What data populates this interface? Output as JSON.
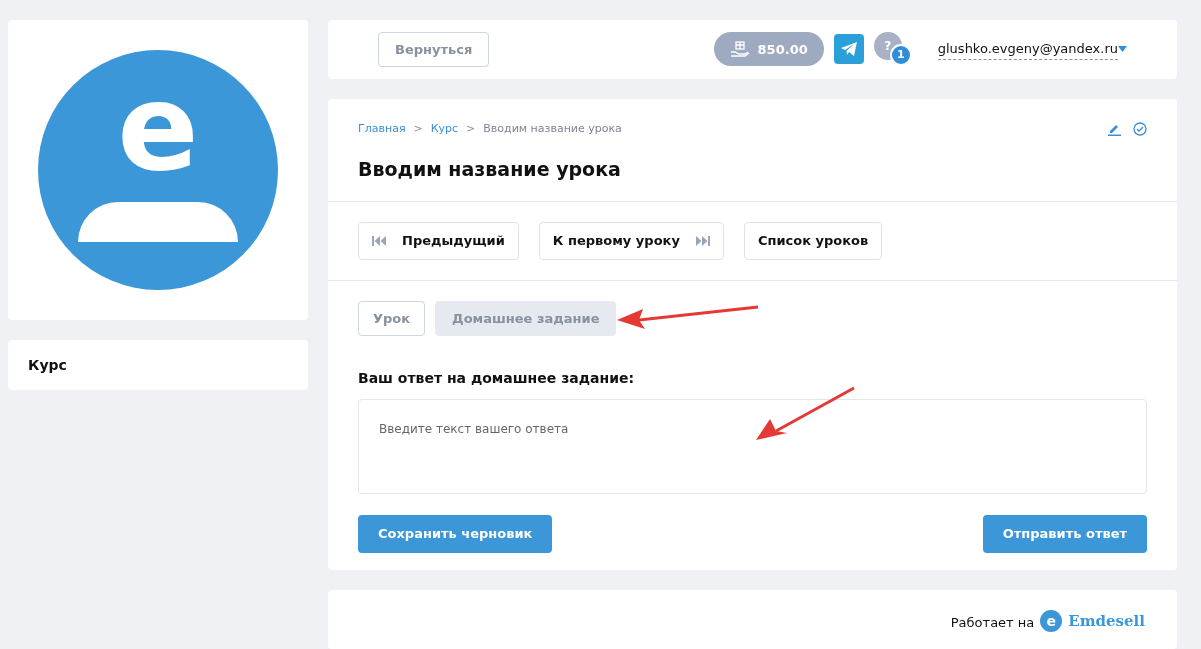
{
  "sidebar": {
    "avatar_letter": "e",
    "menu": [
      {
        "label": "Курс"
      }
    ]
  },
  "header": {
    "back_button": "Вернуться",
    "balance": "850.00",
    "help_badge": "1",
    "help_mark": "?",
    "email": "glushko.evgeny@yandex.ru"
  },
  "breadcrumbs": [
    {
      "label": "Главная",
      "kind": "link"
    },
    {
      "label": "Курс",
      "kind": "link"
    },
    {
      "label": "Вводим название урока",
      "kind": "current"
    }
  ],
  "breadcrumb_separator": ">",
  "title": "Вводим название урока",
  "nav_buttons": [
    {
      "label": "Предыдущий",
      "kind": "prev"
    },
    {
      "label": "К первому уроку",
      "kind": "next"
    },
    {
      "label": "Список уроков",
      "kind": "plain"
    }
  ],
  "tabs": [
    {
      "label": "Урок",
      "selected": false
    },
    {
      "label": "Домашнее задание",
      "selected": true
    }
  ],
  "answer": {
    "label": "Ваш ответ на домашнее задание:",
    "placeholder": "Введите текст вашего ответа"
  },
  "actions": {
    "save": "Сохранить черновик",
    "submit": "Отправить ответ"
  },
  "footer": {
    "powered_by": "Работает на",
    "logo_letter": "e",
    "logo_text": "Emdesell"
  }
}
